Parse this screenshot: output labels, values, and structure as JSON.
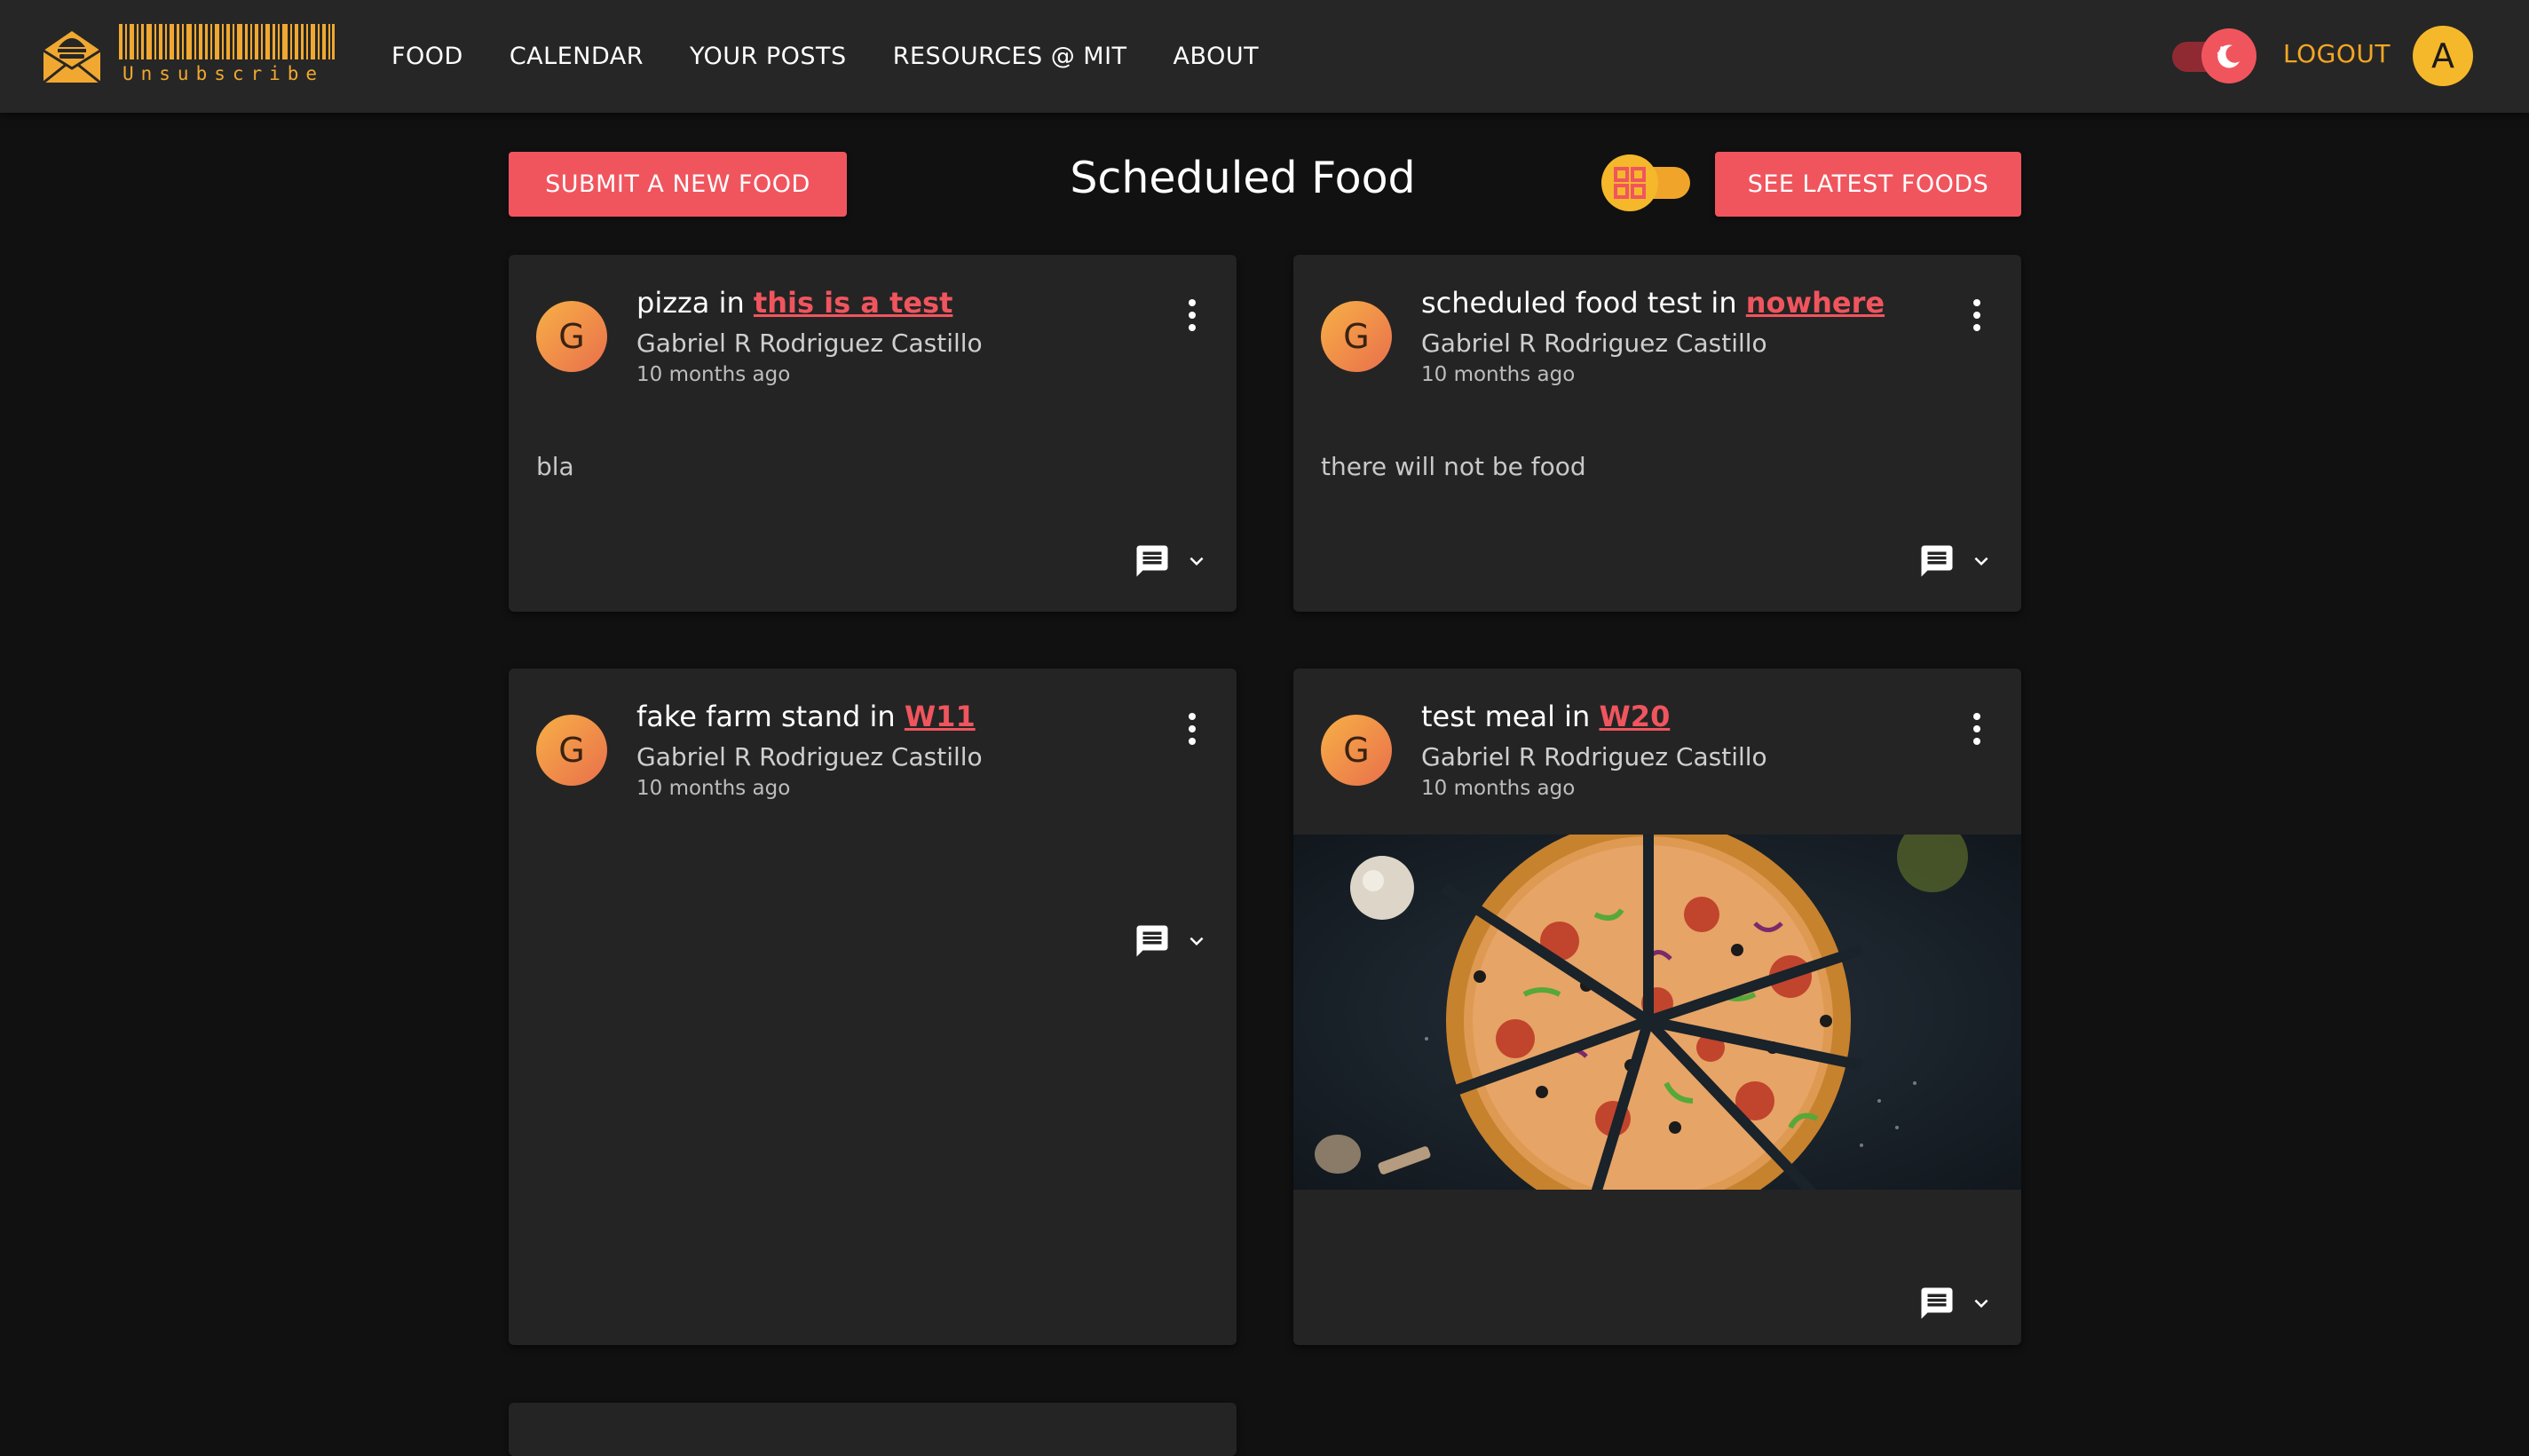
{
  "navbar": {
    "logo_text": "Unsubscribe",
    "links": [
      {
        "label": "FOOD"
      },
      {
        "label": "CALENDAR"
      },
      {
        "label": "YOUR POSTS"
      },
      {
        "label": "RESOURCES @ MIT"
      },
      {
        "label": "ABOUT"
      }
    ],
    "logout_label": "LOGOUT",
    "user_initial": "A",
    "theme_toggle": {
      "state": "dark",
      "icon": "moon-icon"
    }
  },
  "header": {
    "submit_label": "SUBMIT A NEW FOOD",
    "title": "Scheduled Food",
    "view_toggle": {
      "icon": "grid-icon",
      "state": "grid"
    },
    "latest_label": "SEE LATEST FOODS"
  },
  "posts": [
    {
      "avatar_initial": "G",
      "title": "pizza",
      "location_prefix": "in",
      "location": "this is a test",
      "author": "Gabriel R Rodriguez Castillo",
      "time": "10 months ago",
      "body": "bla"
    },
    {
      "avatar_initial": "G",
      "title": "scheduled food test",
      "location_prefix": "in",
      "location": "nowhere",
      "author": "Gabriel R Rodriguez Castillo",
      "time": "10 months ago",
      "body": "there will not be food"
    },
    {
      "avatar_initial": "G",
      "title": "fake farm stand",
      "location_prefix": "in",
      "location": "W11",
      "author": "Gabriel R Rodriguez Castillo",
      "time": "10 months ago",
      "body": ""
    },
    {
      "avatar_initial": "G",
      "title": "test meal",
      "location_prefix": "in",
      "location": "W20",
      "author": "Gabriel R Rodriguez Castillo",
      "time": "10 months ago",
      "body": "",
      "image": "pizza-photo"
    }
  ],
  "colors": {
    "accent_red": "#f0555e",
    "accent_yellow": "#f5a623",
    "background": "#111111",
    "navbar": "#262626",
    "card": "#242424"
  }
}
